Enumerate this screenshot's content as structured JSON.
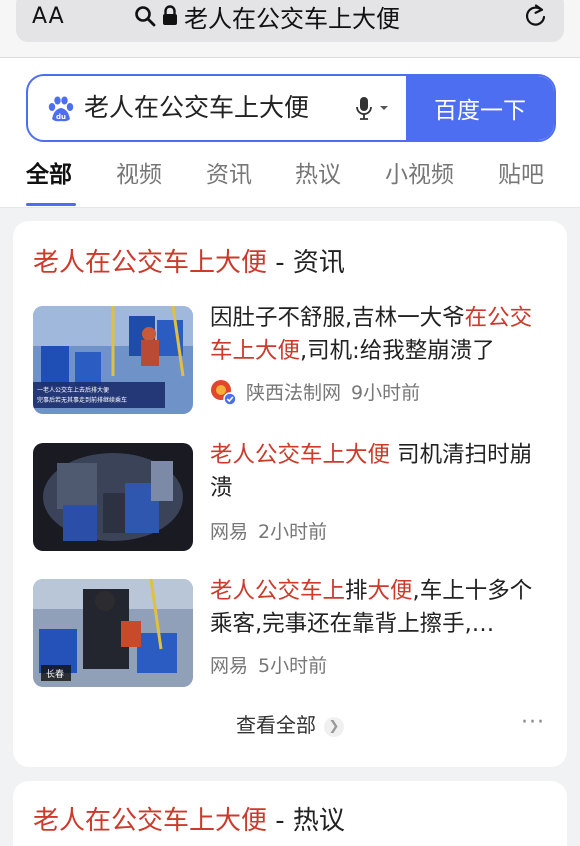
{
  "browser": {
    "aa_label": "AA",
    "address_text": "老人在公交车上大便"
  },
  "search": {
    "query": "老人在公交车上大便",
    "button_label": "百度一下"
  },
  "tabs": [
    {
      "label": "全部",
      "active": true
    },
    {
      "label": "视频",
      "active": false
    },
    {
      "label": "资讯",
      "active": false
    },
    {
      "label": "热议",
      "active": false
    },
    {
      "label": "小视频",
      "active": false
    },
    {
      "label": "贴吧",
      "active": false
    }
  ],
  "news_card": {
    "title_keyword": "老人在公交车上大便",
    "title_suffix": " - 资讯",
    "items": [
      {
        "segments": [
          {
            "text": "因肚子不舒服,吉林一大爷",
            "hl": false
          },
          {
            "text": "在公交车上大便",
            "hl": true
          },
          {
            "text": ",司机:给我整崩溃了",
            "hl": false
          }
        ],
        "source": "陕西法制网",
        "time": "9小时前",
        "thumb_caption_1": "一老人公交车上去后排大便",
        "thumb_caption_2": "完事后若无其事走到前排继续乘车"
      },
      {
        "segments": [
          {
            "text": "老人公交车上大便",
            "hl": true
          },
          {
            "text": " 司机清扫时崩溃",
            "hl": false
          }
        ],
        "source": "网易",
        "time": "2小时前"
      },
      {
        "segments": [
          {
            "text": "老人公交车上",
            "hl": true
          },
          {
            "text": "排",
            "hl": false
          },
          {
            "text": "大便",
            "hl": true
          },
          {
            "text": ",车上十多个乘客,完事还在靠背上擦手,…",
            "hl": false
          }
        ],
        "source": "网易",
        "time": "5小时前",
        "thumb_badge": "长春"
      }
    ],
    "view_all_label": "查看全部",
    "more_label": "···"
  },
  "hot_card": {
    "title_keyword": "老人在公交车上大便",
    "title_suffix": " - 热议"
  },
  "colors": {
    "accent": "#4e6ef2",
    "highlight": "#cd3a2b"
  }
}
